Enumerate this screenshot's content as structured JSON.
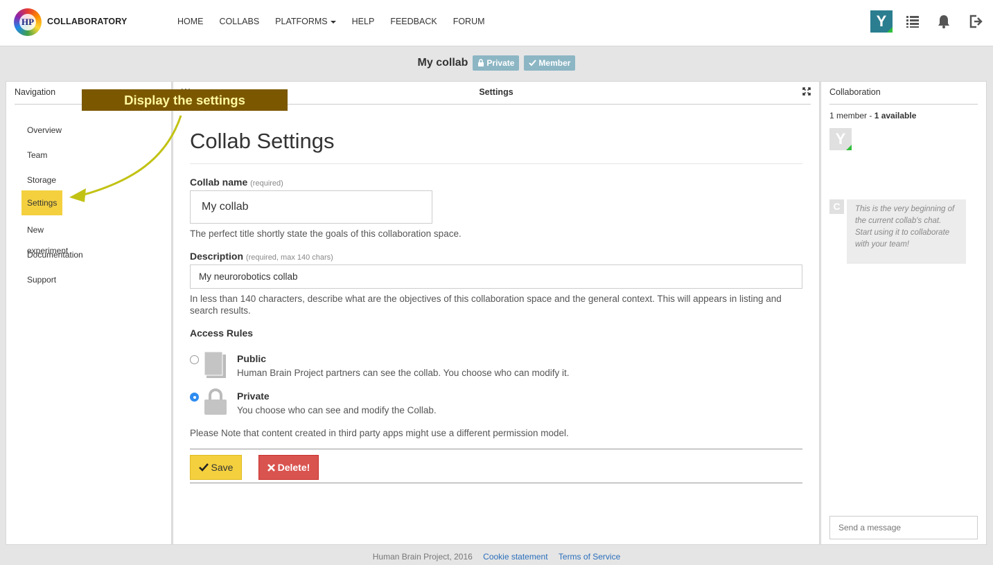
{
  "brand": {
    "logo_text": "HP",
    "name": "COLLABORATORY"
  },
  "topnav": {
    "items": [
      "HOME",
      "COLLABS",
      "PLATFORMS",
      "HELP",
      "FEEDBACK",
      "FORUM"
    ],
    "user_initial": "Y"
  },
  "collab": {
    "name": "My collab",
    "badge_private": "Private",
    "badge_member": "Member"
  },
  "navigation": {
    "title": "Navigation",
    "items": [
      "Overview",
      "Team",
      "Storage",
      "Settings",
      "New experiment",
      "Documentation",
      "Support"
    ],
    "active": "Settings"
  },
  "annotation": {
    "text": "Display the settings"
  },
  "workspace": {
    "head_left": "Wo",
    "head_center": "Settings",
    "heading": "Collab Settings",
    "name_label": "Collab name",
    "name_req": "(required)",
    "name_value": "My collab",
    "name_help": "The perfect title shortly state the goals of this collaboration space.",
    "desc_label": "Description",
    "desc_req": "(required, max 140 chars)",
    "desc_value": "My neurorobotics collab",
    "desc_help": "In less than 140 characters, describe what are the objectives of this collaboration space and the general context. This will appears in listing and search results.",
    "access_label": "Access Rules",
    "public_title": "Public",
    "public_desc": "Human Brain Project partners can see the collab. You choose who can modify it.",
    "private_title": "Private",
    "private_desc": "You choose who can see and modify the Collab.",
    "selected_access": "Private",
    "note": "Please Note that content created in third party apps might use a different permission model.",
    "save_label": "Save",
    "delete_label": "Delete!"
  },
  "collaboration": {
    "title": "Collaboration",
    "member_count": "1 member - ",
    "available": "1 available",
    "member_initial": "Y",
    "chat_initial": "C",
    "chat_intro": "This is the very beginning of the current collab's chat. Start using it to collaborate with your team!",
    "message_placeholder": "Send a message"
  },
  "footer": {
    "copyright": "Human Brain Project, 2016",
    "cookie": "Cookie statement",
    "terms": "Terms of Service"
  },
  "colors": {
    "accent_yellow": "#f4d03f",
    "badge_blue": "#8cb6c4",
    "avatar_teal": "#2a7e8f",
    "delete_red": "#d9534f",
    "annotation_brown": "#7b5800"
  }
}
